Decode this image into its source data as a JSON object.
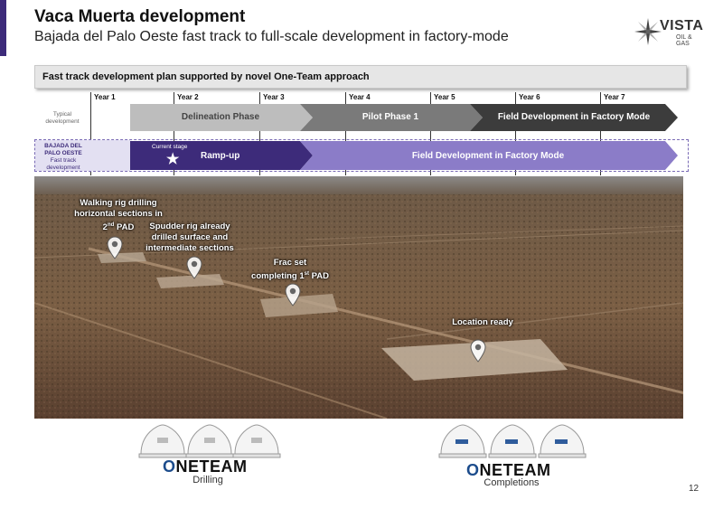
{
  "colors": {
    "accent": "#3d2b7a",
    "phase_light": "#bdbdbd",
    "phase_mid": "#7a7a7a",
    "phase_dark": "#3c3c3c",
    "purple_dark": "#3d2b7a",
    "purple_light": "#8b7cc8"
  },
  "header": {
    "title": "Vaca Muerta development",
    "subtitle": "Bajada del Palo Oeste fast track to full-scale development in factory-mode"
  },
  "logo": {
    "name": "VISTA",
    "sub": "OIL & GAS",
    "icon": "star-logo-icon"
  },
  "section": {
    "heading": "Fast track development plan supported by novel One-Team approach"
  },
  "timeline": {
    "years": [
      "Year 1",
      "Year 2",
      "Year 3",
      "Year 4",
      "Year 5",
      "Year 6",
      "Year 7"
    ],
    "typical": {
      "label_line1": "Typical",
      "label_line2": "development",
      "phases": [
        "Delineation Phase",
        "Pilot Phase 1",
        "Field Development in Factory Mode"
      ]
    },
    "bdpo": {
      "label_line1": "BAJADA DEL",
      "label_line2": "PALO OESTE",
      "label_line3": "Fast track",
      "label_line4": "development",
      "current_stage": "Current stage",
      "rampup": "Ramp-up",
      "factory": "Field Development in Factory Mode"
    }
  },
  "photo": {
    "callouts": [
      {
        "line1": "Walking rig drilling",
        "line2": "horizontal sections in",
        "line3_pre": "2",
        "line3_sup": "nd",
        "line3_post": " PAD"
      },
      {
        "line1": "Spudder rig already",
        "line2": "drilled surface and",
        "line3": "intermediate sections"
      },
      {
        "line1": "Frac set",
        "line2_pre": "completing 1",
        "line2_sup": "st",
        "line2_post": " PAD"
      },
      {
        "line1": "Location ready"
      }
    ]
  },
  "teams": [
    {
      "logo_o": "O",
      "logo_rest": "NETEAM",
      "caption": "Drilling"
    },
    {
      "logo_o": "O",
      "logo_rest": "NETEAM",
      "caption": "Completions"
    }
  ],
  "page_number": "12"
}
